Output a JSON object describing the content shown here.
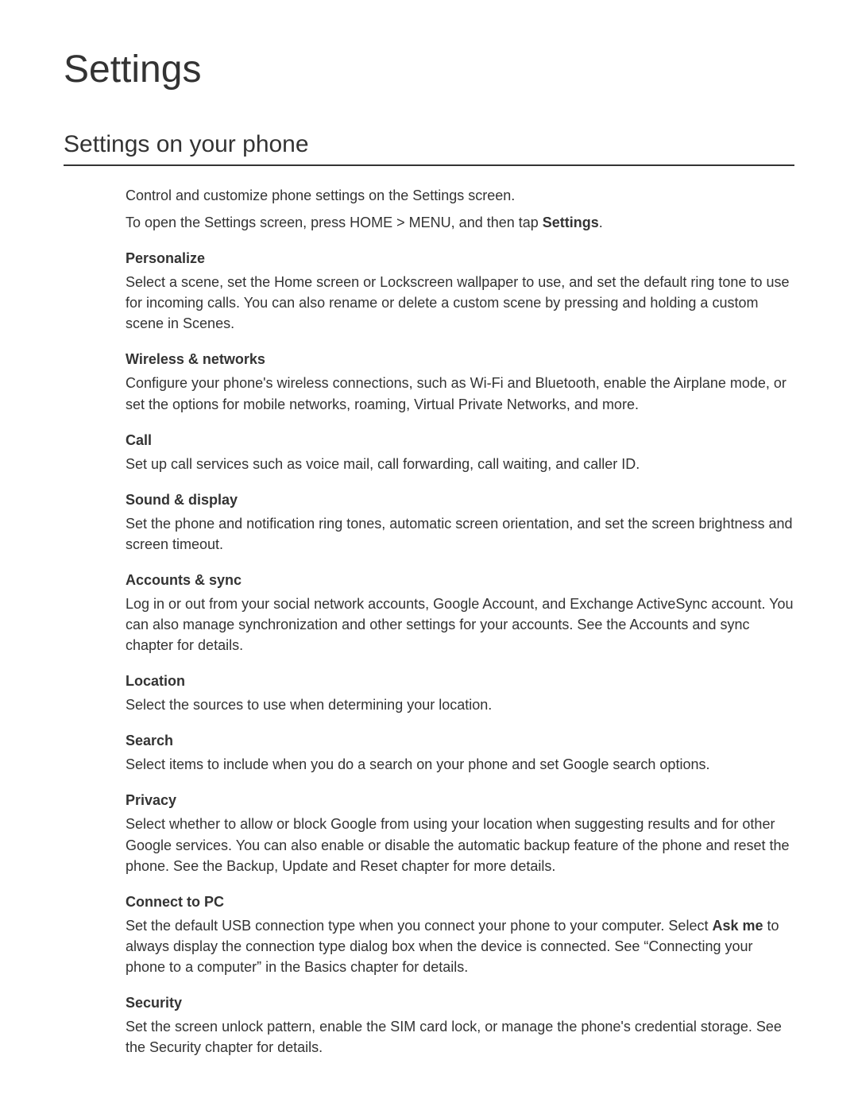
{
  "page": {
    "title": "Settings",
    "section_title": "Settings on your phone",
    "intro_line1": "Control and customize phone settings on the Settings screen.",
    "intro_line2_a": "To open the Settings screen, press HOME > MENU, and then tap ",
    "intro_line2_b": "Settings",
    "intro_line2_c": "."
  },
  "items": {
    "personalize": {
      "heading": "Personalize",
      "body": "Select a scene, set the Home screen or Lockscreen wallpaper to use, and set the default ring tone to use for incoming calls. You can also rename or delete a custom scene by pressing and holding a custom scene in Scenes."
    },
    "wireless": {
      "heading": "Wireless & networks",
      "body": "Configure your phone's wireless connections, such as Wi-Fi and Bluetooth, enable the Airplane mode, or set the options for mobile networks, roaming, Virtual Private Networks, and more."
    },
    "call": {
      "heading": "Call",
      "body": "Set up call services such as voice mail, call forwarding, call waiting, and caller ID."
    },
    "sound": {
      "heading": "Sound & display",
      "body": "Set the phone and notification ring tones, automatic screen orientation, and set the screen brightness and screen timeout."
    },
    "accounts": {
      "heading": "Accounts & sync",
      "body": "Log in or out from your social network accounts, Google Account, and Exchange ActiveSync account. You can also manage synchronization and other settings for your accounts. See the Accounts and sync chapter for details."
    },
    "location": {
      "heading": "Location",
      "body": "Select the sources to use when determining your location."
    },
    "search": {
      "heading": "Search",
      "body": "Select items to include when you do a search on your phone and set Google search options."
    },
    "privacy": {
      "heading": "Privacy",
      "body": "Select whether to allow or block Google from using your location when suggesting results and for other Google services. You can also enable or disable the automatic backup feature of the phone and reset the phone. See the Backup, Update and Reset chapter for more details."
    },
    "connect": {
      "heading": "Connect to PC",
      "body_a": "Set the default USB connection type when you connect your phone to your computer. Select ",
      "body_bold": "Ask me",
      "body_b": " to always display the connection type dialog box when the device is connected. See “Connecting your phone to a computer” in the Basics chapter for details."
    },
    "security": {
      "heading": "Security",
      "body": "Set the screen unlock pattern, enable the SIM card lock, or manage the phone's credential storage. See the Security chapter for details."
    }
  }
}
